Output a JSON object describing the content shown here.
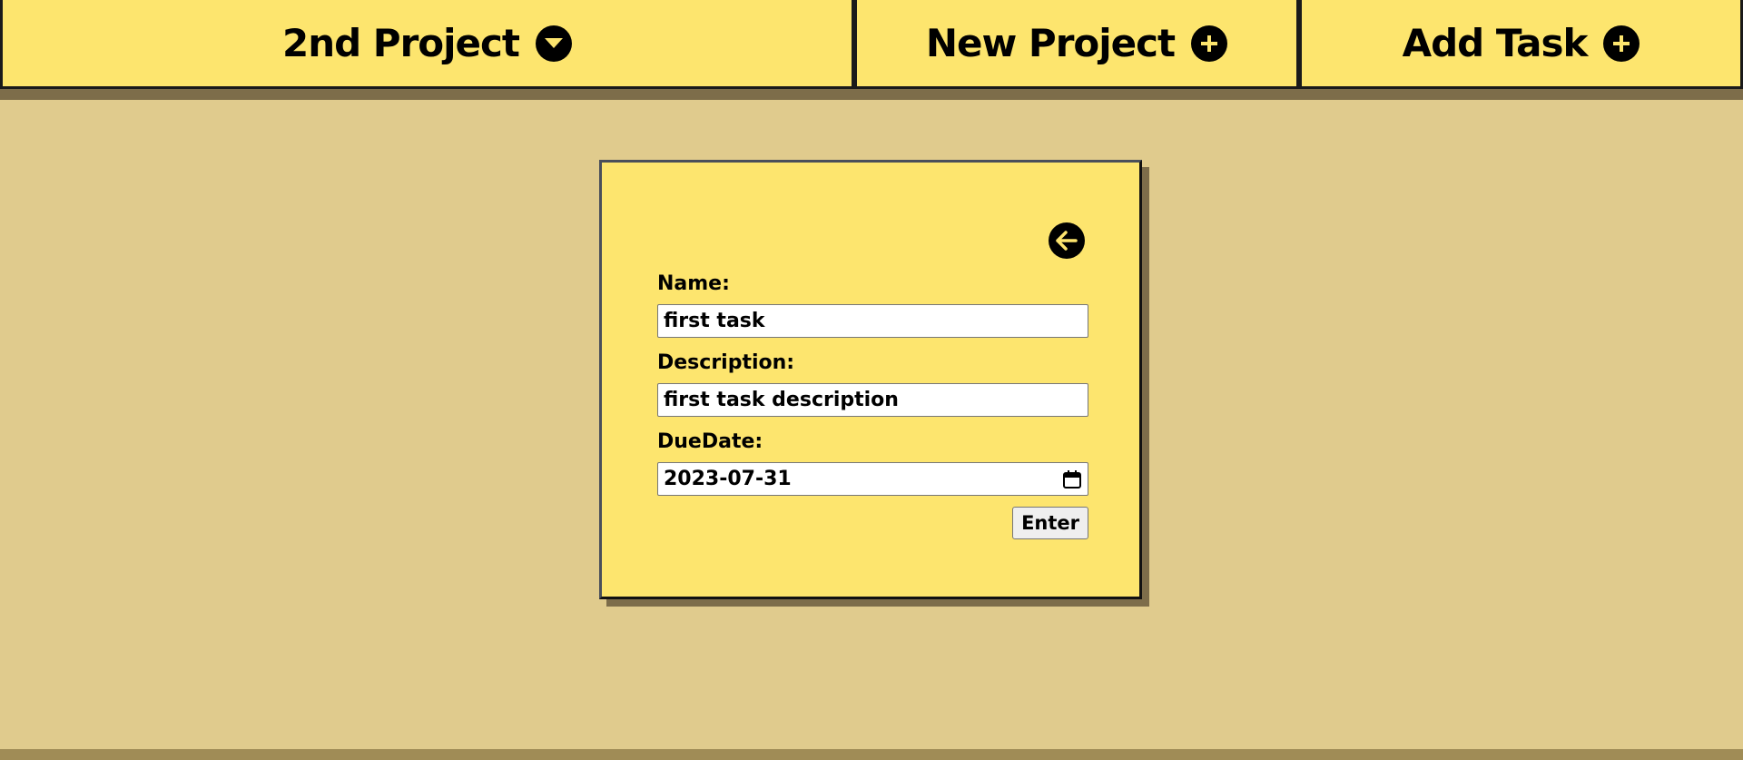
{
  "header": {
    "project_select": {
      "label": "2nd Project",
      "icon": "chevron-down-circle-icon"
    },
    "new_project": {
      "label": "New Project",
      "icon": "plus-circle-icon"
    },
    "add_task": {
      "label": "Add Task",
      "icon": "plus-circle-icon"
    }
  },
  "task_form": {
    "back_icon": "arrow-left-circle-icon",
    "name_label": "Name:",
    "name_value": "first task",
    "description_label": "Description:",
    "description_value": "first task description",
    "due_date_label": "DueDate:",
    "due_date_value": "2023-07-31",
    "calendar_icon": "calendar-icon",
    "enter_label": "Enter"
  },
  "colors": {
    "background": "#e0cb8d",
    "panel": "#fde56e",
    "shadow": "#7d6d4a",
    "text": "#000000"
  }
}
